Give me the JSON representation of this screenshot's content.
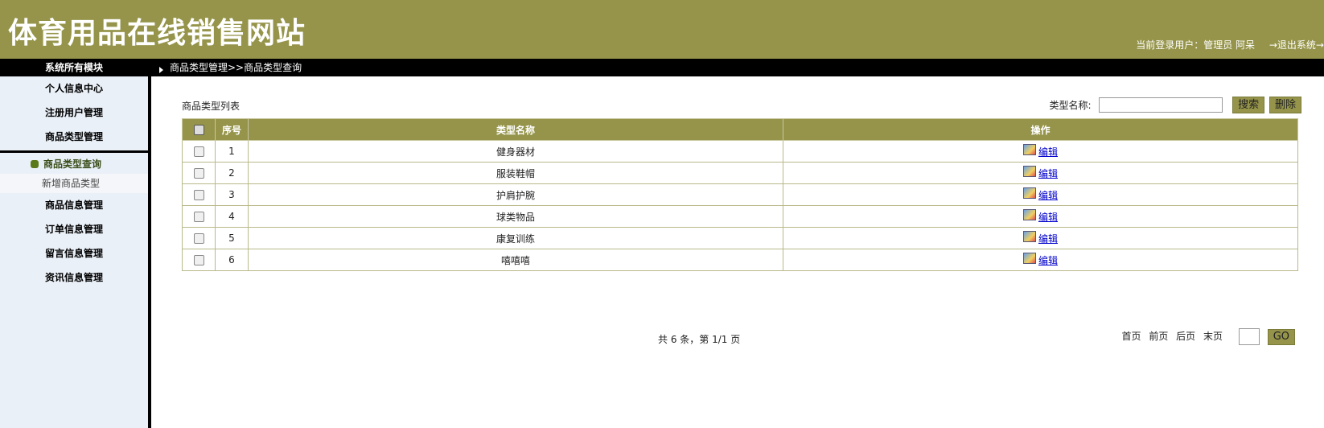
{
  "header": {
    "site_title": "体育用品在线销售网站",
    "current_user_label": "当前登录用户：管理员 阿呆",
    "logout_label": "→退出系统→"
  },
  "nav": {
    "modules_label": "系统所有模块",
    "breadcrumb": "商品类型管理>>商品类型查询"
  },
  "sidebar": {
    "items": [
      {
        "label": "个人信息中心"
      },
      {
        "label": "注册用户管理"
      },
      {
        "label": "商品类型管理"
      }
    ],
    "submenu": [
      {
        "label": "商品类型查询",
        "active": true
      },
      {
        "label": "新增商品类型",
        "active": false
      }
    ],
    "items_after": [
      {
        "label": "商品信息管理"
      },
      {
        "label": "订单信息管理"
      },
      {
        "label": "留言信息管理"
      },
      {
        "label": "资讯信息管理"
      }
    ]
  },
  "main": {
    "list_title": "商品类型列表",
    "search_label": "类型名称:",
    "search_value": "",
    "search_button": "搜索",
    "delete_button": "删除",
    "table": {
      "columns": [
        "",
        "序号",
        "类型名称",
        "操作"
      ],
      "rows": [
        {
          "no": "1",
          "name": "健身器材",
          "action": "编辑"
        },
        {
          "no": "2",
          "name": "服装鞋帽",
          "action": "编辑"
        },
        {
          "no": "3",
          "name": "护肩护腕",
          "action": "编辑"
        },
        {
          "no": "4",
          "name": "球类物品",
          "action": "编辑"
        },
        {
          "no": "5",
          "name": "康复训练",
          "action": "编辑"
        },
        {
          "no": "6",
          "name": "嘻嘻嘻",
          "action": "编辑"
        }
      ]
    },
    "pager": {
      "info": "共 6 条，第 1/1 页",
      "first": "首页",
      "prev": "前页",
      "next": "后页",
      "last": "末页",
      "page_input": "",
      "go": "GO"
    }
  },
  "colors": {
    "brand": "#95944a",
    "nav_black": "#000000",
    "sidebar_bg": "#eaf0f8"
  }
}
